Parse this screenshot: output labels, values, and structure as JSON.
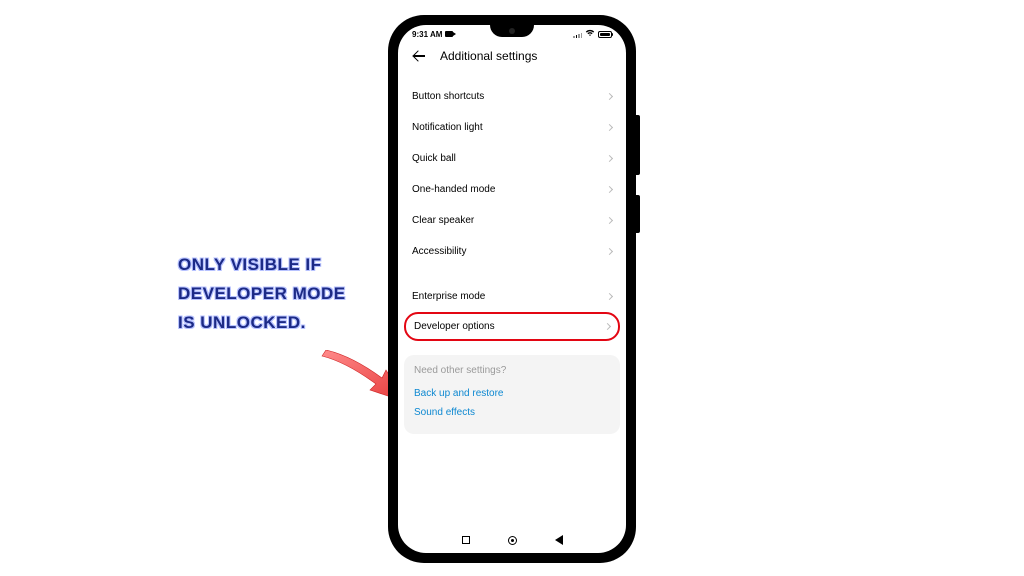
{
  "status": {
    "time": "9:31 AM"
  },
  "header": {
    "title": "Additional settings"
  },
  "cut_item_label": ". . . . . . . . . . . . . . . . .",
  "items": [
    {
      "label": "Button shortcuts"
    },
    {
      "label": "Notification light"
    },
    {
      "label": "Quick ball"
    },
    {
      "label": "One-handed mode"
    },
    {
      "label": "Clear speaker"
    },
    {
      "label": "Accessibility"
    }
  ],
  "items2": [
    {
      "label": "Enterprise mode"
    }
  ],
  "dev_label": "Developer options",
  "footer": {
    "question": "Need other settings?",
    "links": [
      "Back up and restore",
      "Sound effects"
    ]
  },
  "annotation": {
    "line1": "Only visible if",
    "line2": "Developer Mode",
    "line3": "is unlocked."
  },
  "colors": {
    "highlight_border": "#e30613",
    "link": "#0d88d1",
    "anno_text": "#1c2a86"
  }
}
